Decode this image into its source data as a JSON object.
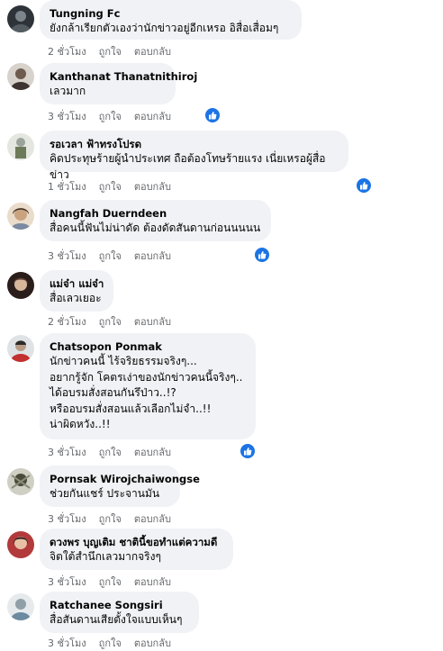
{
  "comments": [
    {
      "author": "Tungning Fc",
      "text": "ยังกล้าเรียกตัวเองว่านักข่าวอยู่อีกเหรอ อิสื่อเสื่อมๆ",
      "time": "2 ชั่วโมง",
      "like": "ถูกใจ",
      "reply": "ตอบกลับ",
      "reaction": null,
      "avatar_color": "#2d3338"
    },
    {
      "author": "Kanthanat Thanatnithiroj",
      "text": "เลวมาก",
      "time": "3 ชั่วโมง",
      "like": "ถูกใจ",
      "reply": "ตอบกลับ",
      "reaction": "like-icon",
      "avatar_color": "#6e5a4e"
    },
    {
      "author": "รอเวลา ฟ้าทรงโปรด",
      "text": "คิดประทุษร้ายผู้นำประเทศ ถือต้องโทษร้ายแรง เนี่ยเหรอผู้สื่อข่าว",
      "time": "1 ชั่วโมง",
      "like": "ถูกใจ",
      "reply": "ตอบกลับ",
      "reaction": "like-icon",
      "avatar_color": "#9aa39a"
    },
    {
      "author": "Nangfah Duerndeen",
      "text": "สื่อคนนี้ฟันไม่น่าดัด ต้องดัดสันดานก่อนนนนน",
      "time": "3 ชั่วโมง",
      "like": "ถูกใจ",
      "reply": "ตอบกลับ",
      "reaction": "like-icon",
      "avatar_color": "#c9a27e"
    },
    {
      "author": "แม่จ๋า แม่จ๋า",
      "text": "สื่อเลวเยอะ",
      "time": "2 ชั่วโมง",
      "like": "ถูกใจ",
      "reply": "ตอบกลับ",
      "reaction": null,
      "avatar_color": "#5a3c34"
    },
    {
      "author": "Chatsopon Ponmak",
      "text": "นักข่าวคนนี้ ไร้จริยธรรมจริงๆ...\nอยากรู้จัก โคตรเง่าของนักข่าวคนนี้จริงๆ..\nได้อบรมสั่งสอนกันรึป่าว..!?\nหรืออบรมสั่งสอนแล้วเลือกไม่จำ..!!\nน่าผิดหวัง..!!",
      "time": "3 ชั่วโมง",
      "like": "ถูกใจ",
      "reply": "ตอบกลับ",
      "reaction": "like-icon",
      "avatar_color": "#b89b86"
    },
    {
      "author": "Pornsak Wirojchaiwongse",
      "text": "ช่วยกันแชร์ ประจานมัน",
      "time": "3 ชั่วโมง",
      "like": "ถูกใจ",
      "reply": "ตอบกลับ",
      "reaction": null,
      "avatar_color": "#4a4a3a"
    },
    {
      "author": "ดวงพร บุญเติม ชาตินี้ขอทำแต่ความดี",
      "text": "จิตใต้สำนึกเลวมากจริงๆ",
      "time": "3 ชั่วโมง",
      "like": "ถูกใจ",
      "reply": "ตอบกลับ",
      "reaction": null,
      "avatar_color": "#b23a3a"
    },
    {
      "author": "Ratchanee Songsiri",
      "text": "สื่อสันดานเสียตั้งใจแบบเห็นๆ",
      "time": "3 ชั่วโมง",
      "like": "ถูกใจ",
      "reply": "ตอบกลับ",
      "reaction": null,
      "avatar_color": "#8fa0a8"
    }
  ],
  "colors": {
    "bubble": "#f0f2f5",
    "meta": "#65676b",
    "like_blue": "#1b74e4"
  }
}
